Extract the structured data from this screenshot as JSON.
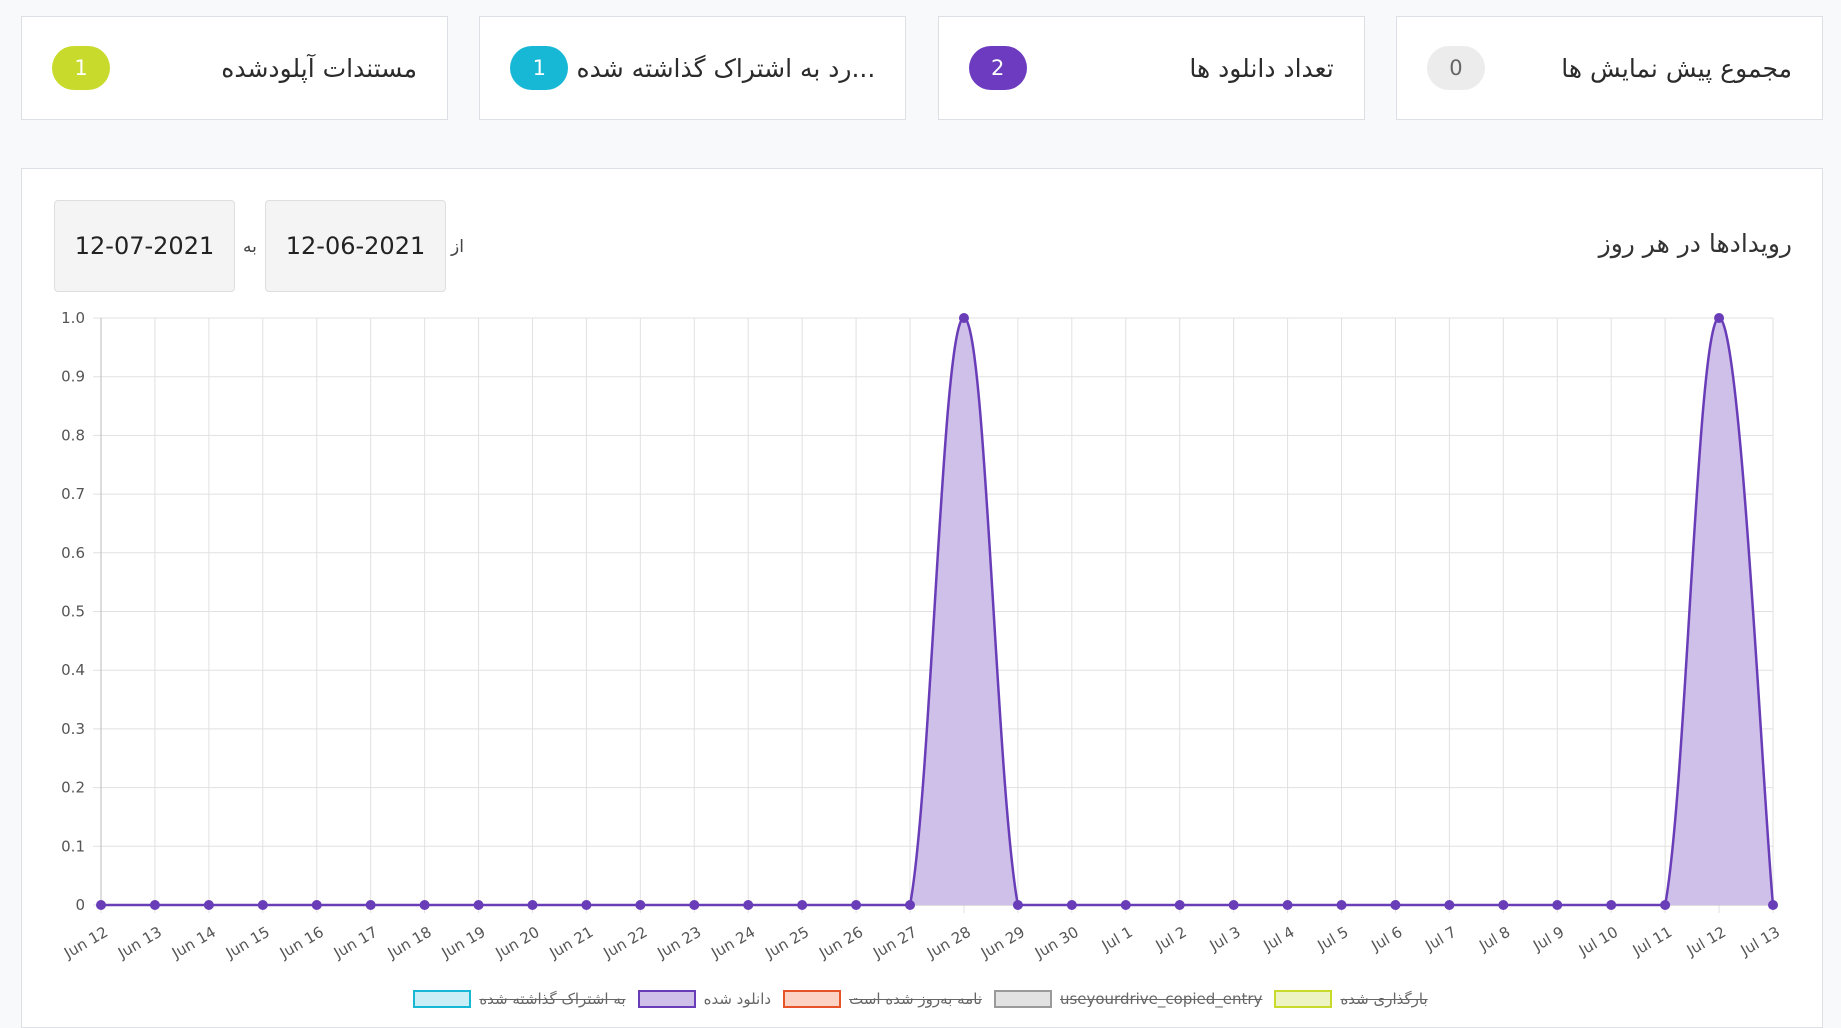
{
  "cards": [
    {
      "title": "مجموع پیش نمایش ها",
      "count": "0",
      "color": "#ececec",
      "text_color": "#666666"
    },
    {
      "title": "تعداد دانلود ها",
      "count": "2",
      "color": "#6c3bbf",
      "text_color": "#ffffff"
    },
    {
      "title": "...رد به اشتراک گذاشته شده",
      "count": "1",
      "color": "#17b8d6",
      "text_color": "#ffffff"
    },
    {
      "title": "مستندات آپلودشده",
      "count": "1",
      "color": "#c8da2b",
      "text_color": "#ffffff"
    }
  ],
  "panel": {
    "title": "رویدادها در هر روز",
    "from_label": "از",
    "from_date": "12-06-2021",
    "to_label": "به",
    "to_date": "12-07-2021"
  },
  "chart_data": {
    "type": "area",
    "categories": [
      "Jun 12",
      "Jun 13",
      "Jun 14",
      "Jun 15",
      "Jun 16",
      "Jun 17",
      "Jun 18",
      "Jun 19",
      "Jun 20",
      "Jun 21",
      "Jun 22",
      "Jun 23",
      "Jun 24",
      "Jun 25",
      "Jun 26",
      "Jun 27",
      "Jun 28",
      "Jun 29",
      "Jun 30",
      "Jul 1",
      "Jul 2",
      "Jul 3",
      "Jul 4",
      "Jul 5",
      "Jul 6",
      "Jul 7",
      "Jul 8",
      "Jul 9",
      "Jul 10",
      "Jul 11",
      "Jul 12",
      "Jul 13"
    ],
    "series": [
      {
        "name": "دانلود شده",
        "values": [
          0,
          0,
          0,
          0,
          0,
          0,
          0,
          0,
          0,
          0,
          0,
          0,
          0,
          0,
          0,
          0,
          1,
          0,
          0,
          0,
          0,
          0,
          0,
          0,
          0,
          0,
          0,
          0,
          0,
          0,
          1,
          0
        ],
        "color": "#6a3db8",
        "fill": "#cfc0ea"
      }
    ],
    "yticks": [
      "0",
      "0.1",
      "0.2",
      "0.3",
      "0.4",
      "0.5",
      "0.6",
      "0.7",
      "0.8",
      "0.9",
      "1.0"
    ],
    "ylim": [
      0,
      1
    ],
    "grid": true,
    "legend": [
      {
        "label": "به اشتراک گذاشته شده",
        "stroke": "#17b8d6",
        "fill": "#c9eef5",
        "hidden": true
      },
      {
        "label": "دانلود شده",
        "stroke": "#6a3db8",
        "fill": "#cfc0ea",
        "hidden": false
      },
      {
        "label": "نامه به‌روز شده است",
        "stroke": "#e8542a",
        "fill": "#fbd2c4",
        "hidden": true
      },
      {
        "label": "useyourdrive_copied_entry",
        "stroke": "#9a9a9a",
        "fill": "#e2e2e2",
        "hidden": true
      },
      {
        "label": "بارگذاری شده",
        "stroke": "#c8da2b",
        "fill": "#eef3c4",
        "hidden": true
      }
    ]
  }
}
